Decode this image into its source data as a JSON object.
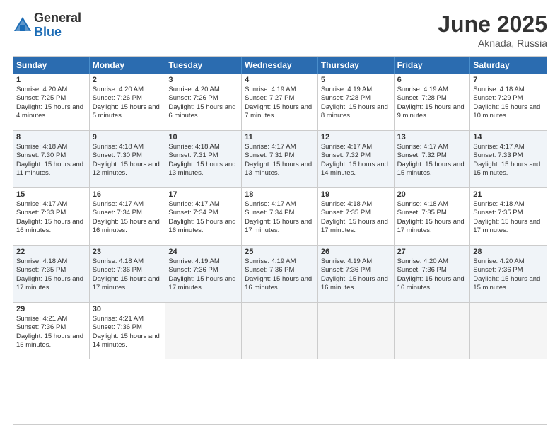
{
  "header": {
    "logo_general": "General",
    "logo_blue": "Blue",
    "month_title": "June 2025",
    "location": "Aknada, Russia"
  },
  "calendar": {
    "days_of_week": [
      "Sunday",
      "Monday",
      "Tuesday",
      "Wednesday",
      "Thursday",
      "Friday",
      "Saturday"
    ],
    "weeks": [
      [
        {
          "day": "",
          "empty": true
        },
        {
          "day": "",
          "empty": true
        },
        {
          "day": "",
          "empty": true
        },
        {
          "day": "",
          "empty": true
        },
        {
          "day": "",
          "empty": true
        },
        {
          "day": "",
          "empty": true
        },
        {
          "day": "",
          "empty": true
        }
      ]
    ],
    "cells": [
      {
        "num": "1",
        "sunrise": "Sunrise: 4:20 AM",
        "sunset": "Sunset: 7:25 PM",
        "daylight": "Daylight: 15 hours and 4 minutes.",
        "empty": false,
        "alt": false
      },
      {
        "num": "2",
        "sunrise": "Sunrise: 4:20 AM",
        "sunset": "Sunset: 7:26 PM",
        "daylight": "Daylight: 15 hours and 5 minutes.",
        "empty": false,
        "alt": false
      },
      {
        "num": "3",
        "sunrise": "Sunrise: 4:20 AM",
        "sunset": "Sunset: 7:26 PM",
        "daylight": "Daylight: 15 hours and 6 minutes.",
        "empty": false,
        "alt": false
      },
      {
        "num": "4",
        "sunrise": "Sunrise: 4:19 AM",
        "sunset": "Sunset: 7:27 PM",
        "daylight": "Daylight: 15 hours and 7 minutes.",
        "empty": false,
        "alt": false
      },
      {
        "num": "5",
        "sunrise": "Sunrise: 4:19 AM",
        "sunset": "Sunset: 7:28 PM",
        "daylight": "Daylight: 15 hours and 8 minutes.",
        "empty": false,
        "alt": false
      },
      {
        "num": "6",
        "sunrise": "Sunrise: 4:19 AM",
        "sunset": "Sunset: 7:28 PM",
        "daylight": "Daylight: 15 hours and 9 minutes.",
        "empty": false,
        "alt": false
      },
      {
        "num": "7",
        "sunrise": "Sunrise: 4:18 AM",
        "sunset": "Sunset: 7:29 PM",
        "daylight": "Daylight: 15 hours and 10 minutes.",
        "empty": false,
        "alt": false
      },
      {
        "num": "8",
        "sunrise": "Sunrise: 4:18 AM",
        "sunset": "Sunset: 7:30 PM",
        "daylight": "Daylight: 15 hours and 11 minutes.",
        "empty": false,
        "alt": true
      },
      {
        "num": "9",
        "sunrise": "Sunrise: 4:18 AM",
        "sunset": "Sunset: 7:30 PM",
        "daylight": "Daylight: 15 hours and 12 minutes.",
        "empty": false,
        "alt": true
      },
      {
        "num": "10",
        "sunrise": "Sunrise: 4:18 AM",
        "sunset": "Sunset: 7:31 PM",
        "daylight": "Daylight: 15 hours and 13 minutes.",
        "empty": false,
        "alt": true
      },
      {
        "num": "11",
        "sunrise": "Sunrise: 4:17 AM",
        "sunset": "Sunset: 7:31 PM",
        "daylight": "Daylight: 15 hours and 13 minutes.",
        "empty": false,
        "alt": true
      },
      {
        "num": "12",
        "sunrise": "Sunrise: 4:17 AM",
        "sunset": "Sunset: 7:32 PM",
        "daylight": "Daylight: 15 hours and 14 minutes.",
        "empty": false,
        "alt": true
      },
      {
        "num": "13",
        "sunrise": "Sunrise: 4:17 AM",
        "sunset": "Sunset: 7:32 PM",
        "daylight": "Daylight: 15 hours and 15 minutes.",
        "empty": false,
        "alt": true
      },
      {
        "num": "14",
        "sunrise": "Sunrise: 4:17 AM",
        "sunset": "Sunset: 7:33 PM",
        "daylight": "Daylight: 15 hours and 15 minutes.",
        "empty": false,
        "alt": true
      },
      {
        "num": "15",
        "sunrise": "Sunrise: 4:17 AM",
        "sunset": "Sunset: 7:33 PM",
        "daylight": "Daylight: 15 hours and 16 minutes.",
        "empty": false,
        "alt": false
      },
      {
        "num": "16",
        "sunrise": "Sunrise: 4:17 AM",
        "sunset": "Sunset: 7:34 PM",
        "daylight": "Daylight: 15 hours and 16 minutes.",
        "empty": false,
        "alt": false
      },
      {
        "num": "17",
        "sunrise": "Sunrise: 4:17 AM",
        "sunset": "Sunset: 7:34 PM",
        "daylight": "Daylight: 15 hours and 16 minutes.",
        "empty": false,
        "alt": false
      },
      {
        "num": "18",
        "sunrise": "Sunrise: 4:17 AM",
        "sunset": "Sunset: 7:34 PM",
        "daylight": "Daylight: 15 hours and 17 minutes.",
        "empty": false,
        "alt": false
      },
      {
        "num": "19",
        "sunrise": "Sunrise: 4:18 AM",
        "sunset": "Sunset: 7:35 PM",
        "daylight": "Daylight: 15 hours and 17 minutes.",
        "empty": false,
        "alt": false
      },
      {
        "num": "20",
        "sunrise": "Sunrise: 4:18 AM",
        "sunset": "Sunset: 7:35 PM",
        "daylight": "Daylight: 15 hours and 17 minutes.",
        "empty": false,
        "alt": false
      },
      {
        "num": "21",
        "sunrise": "Sunrise: 4:18 AM",
        "sunset": "Sunset: 7:35 PM",
        "daylight": "Daylight: 15 hours and 17 minutes.",
        "empty": false,
        "alt": false
      },
      {
        "num": "22",
        "sunrise": "Sunrise: 4:18 AM",
        "sunset": "Sunset: 7:35 PM",
        "daylight": "Daylight: 15 hours and 17 minutes.",
        "empty": false,
        "alt": true
      },
      {
        "num": "23",
        "sunrise": "Sunrise: 4:18 AM",
        "sunset": "Sunset: 7:36 PM",
        "daylight": "Daylight: 15 hours and 17 minutes.",
        "empty": false,
        "alt": true
      },
      {
        "num": "24",
        "sunrise": "Sunrise: 4:19 AM",
        "sunset": "Sunset: 7:36 PM",
        "daylight": "Daylight: 15 hours and 17 minutes.",
        "empty": false,
        "alt": true
      },
      {
        "num": "25",
        "sunrise": "Sunrise: 4:19 AM",
        "sunset": "Sunset: 7:36 PM",
        "daylight": "Daylight: 15 hours and 16 minutes.",
        "empty": false,
        "alt": true
      },
      {
        "num": "26",
        "sunrise": "Sunrise: 4:19 AM",
        "sunset": "Sunset: 7:36 PM",
        "daylight": "Daylight: 15 hours and 16 minutes.",
        "empty": false,
        "alt": true
      },
      {
        "num": "27",
        "sunrise": "Sunrise: 4:20 AM",
        "sunset": "Sunset: 7:36 PM",
        "daylight": "Daylight: 15 hours and 16 minutes.",
        "empty": false,
        "alt": true
      },
      {
        "num": "28",
        "sunrise": "Sunrise: 4:20 AM",
        "sunset": "Sunset: 7:36 PM",
        "daylight": "Daylight: 15 hours and 15 minutes.",
        "empty": false,
        "alt": true
      },
      {
        "num": "29",
        "sunrise": "Sunrise: 4:21 AM",
        "sunset": "Sunset: 7:36 PM",
        "daylight": "Daylight: 15 hours and 15 minutes.",
        "empty": false,
        "alt": false
      },
      {
        "num": "30",
        "sunrise": "Sunrise: 4:21 AM",
        "sunset": "Sunset: 7:36 PM",
        "daylight": "Daylight: 15 hours and 14 minutes.",
        "empty": false,
        "alt": false
      },
      {
        "num": "",
        "empty": true,
        "alt": false
      },
      {
        "num": "",
        "empty": true,
        "alt": false
      },
      {
        "num": "",
        "empty": true,
        "alt": false
      },
      {
        "num": "",
        "empty": true,
        "alt": false
      },
      {
        "num": "",
        "empty": true,
        "alt": false
      }
    ]
  }
}
